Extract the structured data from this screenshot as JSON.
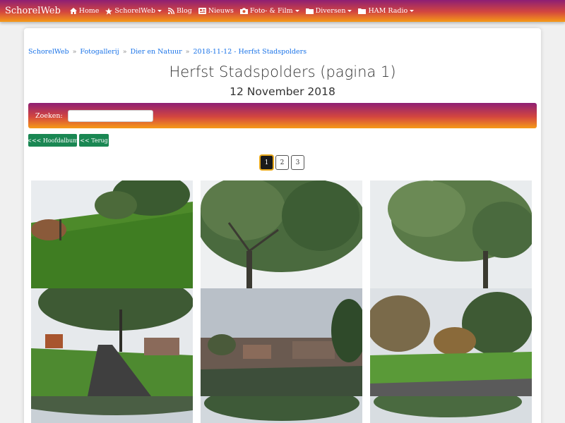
{
  "navbar": {
    "brand": "SchorelWeb",
    "items": [
      {
        "label": "Home",
        "icon": "home-icon",
        "dropdown": false
      },
      {
        "label": "SchorelWeb",
        "icon": "star-icon",
        "dropdown": true
      },
      {
        "label": "Blog",
        "icon": "rss-icon",
        "dropdown": false
      },
      {
        "label": "Nieuws",
        "icon": "newspaper-icon",
        "dropdown": false
      },
      {
        "label": "Foto- & Film",
        "icon": "camera-icon",
        "dropdown": true
      },
      {
        "label": "Diversen",
        "icon": "folder-icon",
        "dropdown": true
      },
      {
        "label": "HAM Radio",
        "icon": "folder-icon",
        "dropdown": true
      }
    ]
  },
  "breadcrumb": {
    "items": [
      "SchorelWeb",
      "Fotogallerij",
      "Dier en Natuur",
      "2018-11-12 - Herfst Stadspolders"
    ],
    "separator": "»"
  },
  "page": {
    "title": "Herfst Stadspolders (pagina 1)",
    "subtitle": "12 November 2018"
  },
  "search": {
    "label": "Zoeken:",
    "value": ""
  },
  "buttons": {
    "main_album": "<<< Hoofdalbum",
    "back": "<< Terug"
  },
  "pagination": {
    "pages": [
      "1",
      "2",
      "3"
    ],
    "current": "1"
  },
  "colors": {
    "gradient_top": "#8e1f74",
    "gradient_mid": "#d4473e",
    "gradient_bottom": "#f69a17",
    "link": "#1a73e8",
    "button_green": "#1a8753"
  }
}
